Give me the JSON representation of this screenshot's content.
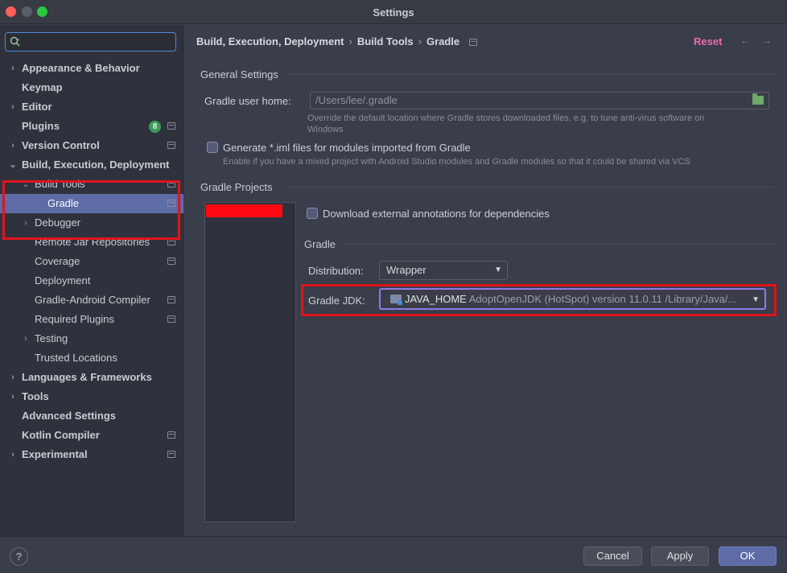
{
  "window": {
    "title": "Settings"
  },
  "sidebar": {
    "search_placeholder": "",
    "items": [
      {
        "label": "Appearance & Behavior"
      },
      {
        "label": "Keymap"
      },
      {
        "label": "Editor"
      },
      {
        "label": "Plugins",
        "badge": "8"
      },
      {
        "label": "Version Control"
      },
      {
        "label": "Build, Execution, Deployment"
      },
      {
        "label": "Build Tools"
      },
      {
        "label": "Gradle"
      },
      {
        "label": "Debugger"
      },
      {
        "label": "Remote Jar Repositories"
      },
      {
        "label": "Coverage"
      },
      {
        "label": "Deployment"
      },
      {
        "label": "Gradle-Android Compiler"
      },
      {
        "label": "Required Plugins"
      },
      {
        "label": "Testing"
      },
      {
        "label": "Trusted Locations"
      },
      {
        "label": "Languages & Frameworks"
      },
      {
        "label": "Tools"
      },
      {
        "label": "Advanced Settings"
      },
      {
        "label": "Kotlin Compiler"
      },
      {
        "label": "Experimental"
      }
    ]
  },
  "breadcrumb": {
    "items": [
      "Build, Execution, Deployment",
      "Build Tools",
      "Gradle"
    ],
    "separator": "›"
  },
  "header": {
    "reset_label": "Reset",
    "back_arrow": "←",
    "forward_arrow": "→"
  },
  "general": {
    "title": "General Settings",
    "user_home_label": "Gradle user home:",
    "user_home_value": "/Users/lee/.gradle",
    "user_home_hint_1": "Override the default location where Gradle stores downloaded files, e.g. to tune anti-virus software on",
    "user_home_hint_2": "Windows",
    "iml_label": "Generate *.iml files for modules imported from Gradle",
    "iml_hint": "Enable if you have a mixed project with Android Studio modules and Gradle modules so that it could be shared via VCS"
  },
  "projects": {
    "title": "Gradle Projects",
    "annotations_label": "Download external annotations for dependencies",
    "gradle_section": "Gradle",
    "distribution_label": "Distribution:",
    "distribution_value": "Wrapper",
    "jdk_label": "Gradle JDK:",
    "jdk_main": "JAVA_HOME",
    "jdk_detail": "AdoptOpenJDK (HotSpot) version 11.0.11 /Library/Java/..."
  },
  "footer": {
    "help": "?",
    "cancel": "Cancel",
    "apply": "Apply",
    "ok": "OK"
  },
  "colors": {
    "accent": "#5d6ba6",
    "reset": "#ee6ca8",
    "highlight": "#e0131b"
  }
}
